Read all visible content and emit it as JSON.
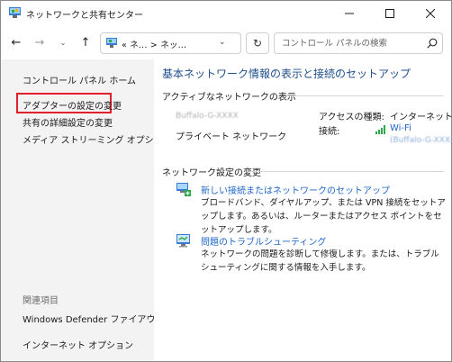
{
  "window": {
    "title": "ネットワークと共有センター",
    "controls": {
      "minimize": "—",
      "maximize": "☐",
      "close": "✕"
    }
  },
  "nav": {
    "back": "←",
    "forward": "→",
    "recent_dropdown": "⌄",
    "up": "↑",
    "address_text": "«  ネ...  >  ネッ...",
    "address_dropdown": "⌄",
    "refresh": "↻",
    "search_placeholder": "コントロール パネルの検索"
  },
  "sidebar": {
    "items": [
      {
        "label": "コントロール パネル ホーム"
      },
      {
        "label": "アダプターの設定の変更",
        "highlighted": true
      },
      {
        "label": "共有の詳細設定の変更"
      },
      {
        "label": "メディア ストリーミング オプション"
      }
    ],
    "related_heading": "関連項目",
    "related": [
      {
        "label": "Windows Defender ファイアウォール"
      },
      {
        "label": "インターネット オプション"
      }
    ],
    "highlight_color": "#e0202c"
  },
  "main": {
    "title": "基本ネットワーク情報の表示と接続のセットアップ",
    "active_heading": "アクティブなネットワークの表示",
    "network": {
      "name_blurred": "Buffalo-G-XXXX",
      "type": "プライベート ネットワーク",
      "access_label": "アクセスの種類:",
      "access_value": "インターネット",
      "connection_label": "接続:",
      "connection_link": "Wi-Fi",
      "connection_sub_blurred": "(Buffalo-G-XXXX)"
    },
    "settings_heading": "ネットワーク設定の変更",
    "tasks": [
      {
        "icon": "new-connection-icon",
        "link": "新しい接続またはネットワークのセットアップ",
        "description": "ブロードバンド、ダイヤルアップ、または VPN 接続をセットアップします。あるいは、ルーターまたはアクセス ポイントをセットアップします。"
      },
      {
        "icon": "troubleshoot-icon",
        "link": "問題のトラブルシューティング",
        "description": "ネットワークの問題を診断して修復します。または、トラブルシューティングに関する情報を入手します。"
      }
    ],
    "link_color": "#1e66c8",
    "title_color": "#1e4e8c"
  }
}
